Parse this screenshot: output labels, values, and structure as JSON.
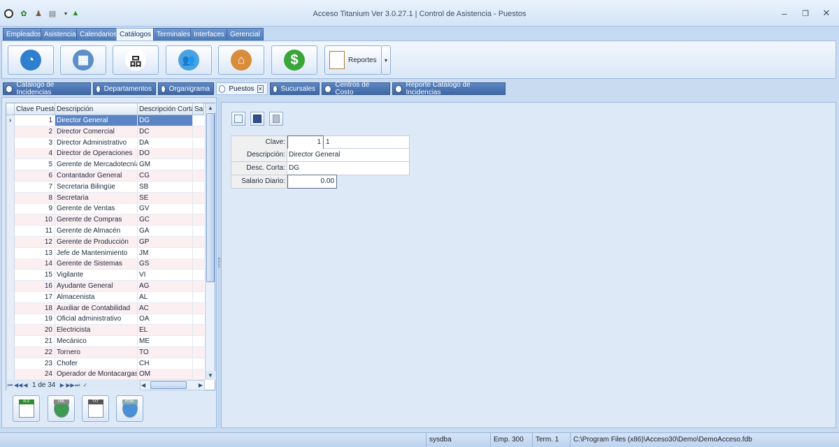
{
  "window": {
    "title": "Acceso Titanium  Ver 3.0.27.1 | Control de Asistencia - Puestos",
    "minimize": "–",
    "restore": "❐",
    "close": "✕"
  },
  "ribbon_tabs": [
    "Empleados",
    "Asistencia",
    "Calendarios",
    "Catálogos",
    "Terminales",
    "Interfaces",
    "Gerencial"
  ],
  "ribbon_active_tab": "Catálogos",
  "ribbon": {
    "buttons": [
      {
        "name": "incidencias-icon",
        "glyph": "◔",
        "bg": "#2f7fd0"
      },
      {
        "name": "building-icon",
        "glyph": "▦",
        "bg": "#5c8fc9"
      },
      {
        "name": "org-chart-icon",
        "glyph": "品",
        "bg": "#ffffff"
      },
      {
        "name": "people-icon",
        "glyph": "👥",
        "bg": "#4aa3e0"
      },
      {
        "name": "store-icon",
        "glyph": "⌂",
        "bg": "#d98c3a"
      },
      {
        "name": "dollar-icon",
        "glyph": "$",
        "bg": "#3aa63a"
      }
    ],
    "reportes_label": "Reportes",
    "dropdown_glyph": "▾"
  },
  "doc_tabs": [
    "Catálogo de Incidencias",
    "Departamentos",
    "Organigrama",
    "Puestos",
    "Sucursales",
    "Centros de Costo",
    "Reporte Catálogo de Incidencias"
  ],
  "doc_active_tab": "Puestos",
  "doc_tab_close": "✕",
  "grid": {
    "columns": [
      "Clave Puesto",
      "Descripción",
      "Descripción Corta",
      "Sala"
    ],
    "row_indicator": "›",
    "rows": [
      [
        "1",
        "Director General",
        "DG"
      ],
      [
        "2",
        "Director Comercial",
        "DC"
      ],
      [
        "3",
        "Director Administrativo",
        "DA"
      ],
      [
        "4",
        "Director de Operaciones",
        "DO"
      ],
      [
        "5",
        "Gerente de Mercadotecnía",
        "GM"
      ],
      [
        "6",
        "Contantador General",
        "CG"
      ],
      [
        "7",
        "Secretaria Bilingüe",
        "SB"
      ],
      [
        "8",
        "Secretaria",
        "SE"
      ],
      [
        "9",
        "Gerente de Ventas",
        "GV"
      ],
      [
        "10",
        "Gerente de Compras",
        "GC"
      ],
      [
        "11",
        "Gerente de Almacén",
        "GA"
      ],
      [
        "12",
        "Gerente de Producción",
        "GP"
      ],
      [
        "13",
        "Jefe de Mantenimiento",
        "JM"
      ],
      [
        "14",
        "Gerente de Sistemas",
        "GS"
      ],
      [
        "15",
        "Vigilante",
        "VI"
      ],
      [
        "16",
        "Ayudante General",
        "AG"
      ],
      [
        "17",
        "Almacenista",
        "AL"
      ],
      [
        "18",
        "Auxiliar de Contabilidad",
        "AC"
      ],
      [
        "19",
        "Oficial administrativo",
        "OA"
      ],
      [
        "20",
        "Electricista",
        "EL"
      ],
      [
        "21",
        "Mecánico",
        "ME"
      ],
      [
        "22",
        "Tornero",
        "TO"
      ],
      [
        "23",
        "Chofer",
        "CH"
      ],
      [
        "24",
        "Operador de Montacargas",
        "OM"
      ]
    ],
    "selected_row": 0,
    "navigator": {
      "page": "1 de 34",
      "first": "⏮",
      "prev_page": "◀◀",
      "prev": "◀",
      "next": "▶",
      "next_page": "▶▶",
      "last": "⏭",
      "confirm": "✓"
    },
    "scroll": {
      "up": "▲",
      "down": "▼",
      "left": "◀",
      "right": "▶"
    }
  },
  "export_buttons": [
    "XLS",
    "XML",
    "TXT",
    "HTML"
  ],
  "form": {
    "clave_label": "Clave:",
    "clave_input": "1",
    "clave_value": "1",
    "descripcion_label": "Descripción:",
    "descripcion_value": "Director General",
    "desc_corta_label": "Desc. Corta:",
    "desc_corta_value": "DG",
    "salario_label": "Salario Diario:",
    "salario_value": "0.00"
  },
  "status_bar": {
    "user": "sysdba",
    "empresa": "Emp. 300",
    "terminal": "Term. 1",
    "database": "C:\\Program Files (x86)\\Acceso30\\Demo\\DemoAcceso.fdb"
  }
}
